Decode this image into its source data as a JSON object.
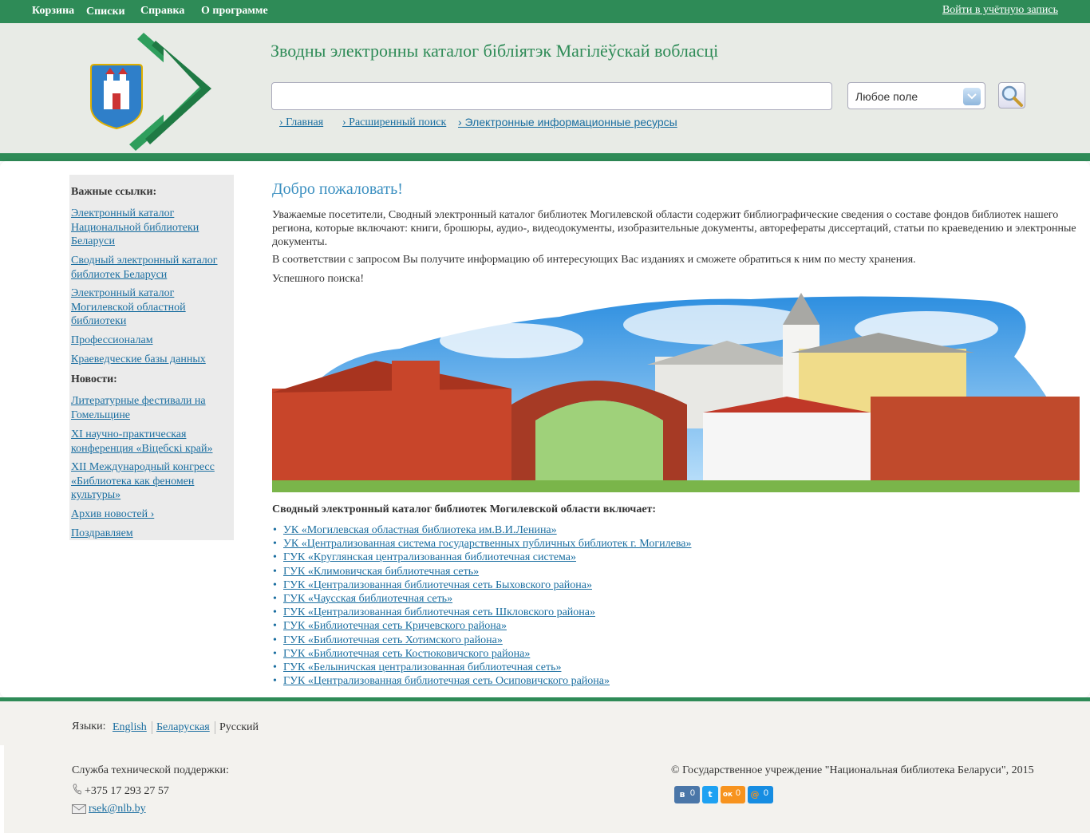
{
  "topbar": {
    "menu": [
      "Корзина",
      "Списки",
      "Справка",
      "О программе"
    ],
    "login": "Войти в учётную запись"
  },
  "header": {
    "title": "Зводны электронны каталог бібліятэк Магілёўскай вобласці",
    "search_value": "",
    "field_select": "Любое поле",
    "nav": [
      "› Главная",
      "› Расширенный поиск",
      "› Электронные информационные ресурсы"
    ]
  },
  "sidebar": {
    "important_heading": "Важные ссылки:",
    "important_links": [
      "Электронный каталог Национальной библиотеки Беларуси",
      "Сводный электронный каталог библиотек Беларуси",
      "Электронный каталог Могилевской областной библиотеки",
      "Профессионалам",
      "Краеведческие базы данных"
    ],
    "news_heading": "Новости:",
    "news_links": [
      "Литературные фестивали на Гомельщине",
      "XI научно-практическая конференция «Віцебскі край»",
      "XII Международный конгресс «Библиотека как феномен культуры»",
      "Архив новостей ›",
      "Поздравляем"
    ]
  },
  "main": {
    "welcome": "Добро пожаловать!",
    "intro": "Уважаемые посетители, Сводный электронный каталог библиотек Могилевской области содержит библиографические сведения о составе фондов библиотек нашего региона, которые включают: книги, брошюры, аудио-, видеодокументы, изобразительные документы, авторефераты диссертаций, статьи по краеведению и электронные документы.",
    "intro2": "В соответствии с запросом Вы получите информацию об интересующих Вас изданиях и сможете обратиться к ним по месту хранения.",
    "intro3": "Успешного поиска!",
    "includes_heading": "Сводный электронный каталог библиотек Могилевской области включает:",
    "libraries": [
      "УК «Могилевская областная библиотека им.В.И.Ленина»",
      "УК «Централизованная система государственных публичных библиотек г. Могилева»",
      "ГУК «Круглянская централизованная библиотечная система»",
      "ГУК «Климовичская библиотечная сеть»",
      "ГУК «Централизованная библиотечная сеть Быховского района»",
      "ГУК «Чаусская библиотечная сеть»",
      "ГУК «Централизованная библиотечная сеть Шкловского района»",
      "ГУК «Библиотечная сеть Кричевского района»",
      "ГУК «Библиотечная сеть Хотимского района»",
      "ГУК «Библиотечная сеть Костюковичского района»",
      "ГУК «Белыничская централизованная библиотечная сеть»",
      "ГУК «Централизованная библиотечная сеть Осиповичского района»"
    ]
  },
  "footer": {
    "languages_label": "Языки:",
    "languages": [
      "English",
      "Беларуская",
      "Русский"
    ],
    "support_label": "Служба технической поддержки:",
    "phone": "+375 17 293 27 57",
    "email": "rsek@nlb.by",
    "copyright": "© Государственное учреждение \"Национальная библиотека Беларуси\", 2015",
    "social": [
      {
        "icon": "vk-icon",
        "glyph": "в",
        "count": "0",
        "color": "#4a76a8"
      },
      {
        "icon": "twitter-icon",
        "glyph": "t",
        "count": "",
        "color": "#1da1f2"
      },
      {
        "icon": "odnoklassniki-icon",
        "glyph": "ок",
        "count": "0",
        "color": "#f7931e"
      },
      {
        "icon": "mailru-icon",
        "glyph": "@",
        "count": "0",
        "color": "#168de2"
      }
    ]
  }
}
